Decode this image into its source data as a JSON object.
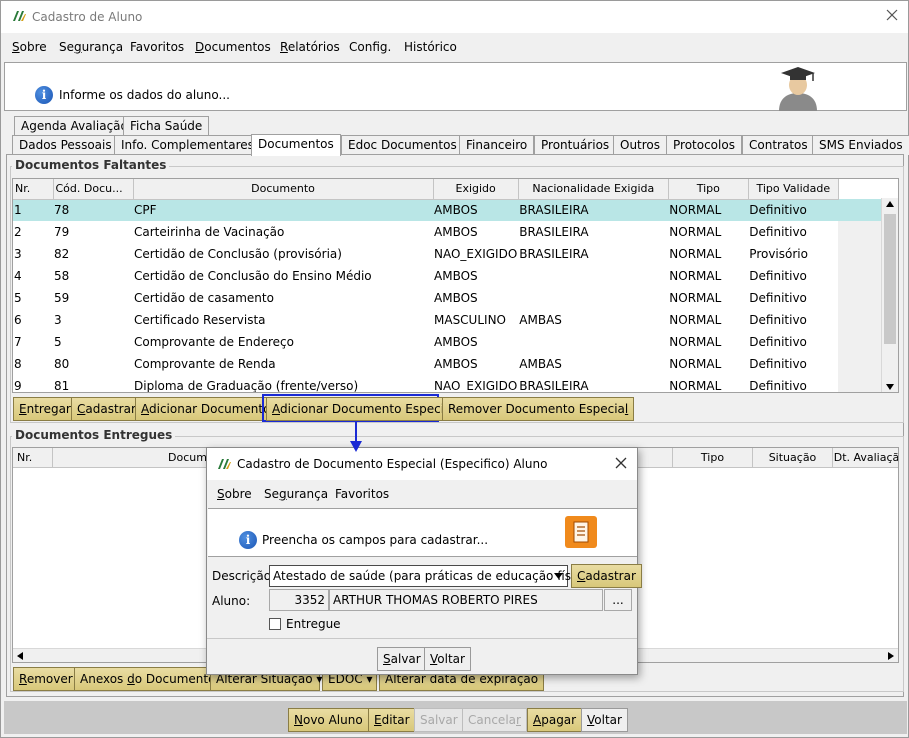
{
  "window": {
    "title": "Cadastro de Aluno"
  },
  "menu": [
    {
      "label_pre": "",
      "label_u": "S",
      "label_post": "obre"
    },
    {
      "label_pre": "Se",
      "label_u": "g",
      "label_post": "urança"
    },
    {
      "label_pre": "Favoritos",
      "label_u": "",
      "label_post": ""
    },
    {
      "label_pre": "",
      "label_u": "D",
      "label_post": "ocumentos"
    },
    {
      "label_pre": "",
      "label_u": "R",
      "label_post": "elatórios"
    },
    {
      "label_pre": "Config.",
      "label_u": "",
      "label_post": ""
    },
    {
      "label_pre": "Histórico",
      "label_u": "",
      "label_post": ""
    }
  ],
  "header": {
    "message": "Informe os dados do aluno..."
  },
  "tabs_row1": [
    "Agenda Avaliação",
    "Ficha Saúde"
  ],
  "tabs_row2": [
    "Dados Pessoais",
    "Info. Complementares",
    "Documentos",
    "Edoc Documentos",
    "Financeiro",
    "Prontuários",
    "Outros",
    "Protocolos",
    "Contratos",
    "SMS Enviados"
  ],
  "active_tab": "Documentos",
  "faltantes": {
    "title": "Documentos Faltantes",
    "columns": [
      "Nr.",
      "Cód. Docu...",
      "Documento",
      "Exigido",
      "Nacionalidade Exigida",
      "Tipo",
      "Tipo Validade"
    ],
    "rows": [
      [
        "1",
        "78",
        "CPF",
        "AMBOS",
        "BRASILEIRA",
        "NORMAL",
        "Definitivo"
      ],
      [
        "2",
        "79",
        "Carteirinha de Vacinação",
        "AMBOS",
        "BRASILEIRA",
        "NORMAL",
        "Definitivo"
      ],
      [
        "3",
        "82",
        "Certidão de Conclusão (provisória)",
        "NAO_EXIGIDO",
        "BRASILEIRA",
        "NORMAL",
        "Provisório"
      ],
      [
        "4",
        "58",
        "Certidão de Conclusão do Ensino Médio",
        "AMBOS",
        "",
        "NORMAL",
        "Definitivo"
      ],
      [
        "5",
        "59",
        "Certidão de casamento",
        "AMBOS",
        "",
        "NORMAL",
        "Definitivo"
      ],
      [
        "6",
        "3",
        "Certificado Reservista",
        "MASCULINO",
        "AMBAS",
        "NORMAL",
        "Definitivo"
      ],
      [
        "7",
        "5",
        "Comprovante de Endereço",
        "AMBOS",
        "",
        "NORMAL",
        "Definitivo"
      ],
      [
        "8",
        "80",
        "Comprovante de Renda",
        "AMBOS",
        "AMBAS",
        "NORMAL",
        "Definitivo"
      ],
      [
        "9",
        "81",
        "Diploma de Graduação (frente/verso)",
        "NAO_EXIGIDO",
        "BRASILEIRA",
        "NORMAL",
        "Definitivo"
      ]
    ],
    "buttons": {
      "entregar_u": "E",
      "entregar_rest": "ntregar",
      "cadastrar_u": "C",
      "cadastrar_rest": "adastrar",
      "adicionar_u": "A",
      "adicionar_rest": "dicionar Documento",
      "adicionar_especial_u": "A",
      "adicionar_especial_rest": "dicionar Documento Especial",
      "remover_especial_pre": "Remover Documento Especia",
      "remover_especial_u": "l"
    }
  },
  "entregues": {
    "title": "Documentos Entregues",
    "columns_visible": [
      "Nr.",
      "Docume",
      "Tipo",
      "Situação",
      "Dt. Avaliaçã"
    ],
    "buttons": {
      "remover_u": "R",
      "remover_rest": "emover",
      "anexos_pre": "Anexos ",
      "anexos_u": "d",
      "anexos_post": "o Documento",
      "alterar_situacao": "Alterar Situação",
      "edoc": "EDOC",
      "alterar_data": "Alterar data de expiração"
    }
  },
  "footer_buttons": {
    "novo_u": "N",
    "novo_rest": "ovo Aluno",
    "editar_u": "E",
    "editar_rest": "ditar",
    "salvar": "Salvar",
    "cancelar_pre": "Cancela",
    "cancelar_u": "r",
    "apagar_u": "A",
    "apagar_rest": "pagar",
    "voltar_u": "V",
    "voltar_rest": "oltar"
  },
  "dialog": {
    "title": "Cadastro de Documento Especial (Especifico) Aluno",
    "menu": [
      {
        "pre": "",
        "u": "S",
        "post": "obre"
      },
      {
        "pre": "Se",
        "u": "g",
        "post": "urança"
      },
      {
        "pre": "Favoritos",
        "u": "",
        "post": ""
      }
    ],
    "message": "Preencha os campos para cadastrar...",
    "descricao_label": "Descrição:",
    "descricao_value": "Atestado de saúde (para práticas de educação física)",
    "cadastrar_u": "C",
    "cadastrar_rest": "adastrar",
    "aluno_label": "Aluno:",
    "aluno_id": "3352",
    "aluno_nome": "ARTHUR THOMAS ROBERTO PIRES",
    "ellipsis": "...",
    "entregue_label": "Entregue",
    "salvar_u": "S",
    "salvar_rest": "alvar",
    "voltar_u": "V",
    "voltar_rest": "oltar"
  },
  "colors": {
    "accent_highlight": "#1a2ad4",
    "button_gold": "#d8c87a",
    "selected_row": "#b9e6e6"
  }
}
